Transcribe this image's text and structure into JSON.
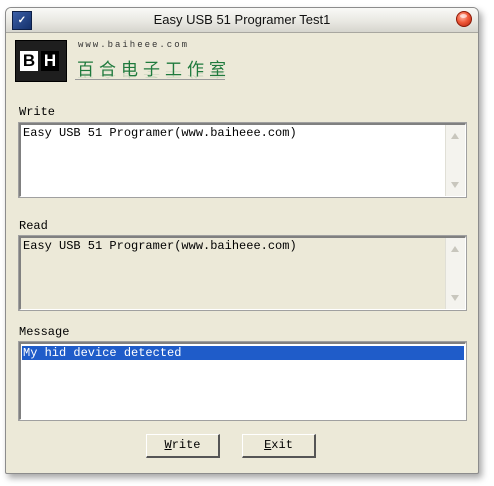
{
  "window": {
    "title": "Easy USB 51 Programer Test1",
    "icon": "app-icon",
    "icon_glyph": "✓",
    "close": "close-icon"
  },
  "logo": {
    "b": "B",
    "h": "H",
    "url": "www.baiheee.com",
    "chinese": "百合电子工作室"
  },
  "write_group": {
    "label": "Write",
    "text": "Easy USB 51 Programer(www.baiheee.com)"
  },
  "read_group": {
    "label": "Read",
    "text": "Easy USB 51 Programer(www.baiheee.com)"
  },
  "message_group": {
    "label": "Message",
    "items": [
      "My hid device detected"
    ],
    "selected_index": 0
  },
  "buttons": {
    "write": "Write",
    "exit": "Exit"
  },
  "colors": {
    "selection": "#1f5cc9",
    "window_bg": "#ece9d8",
    "logo_green": "#1f7a3d"
  }
}
